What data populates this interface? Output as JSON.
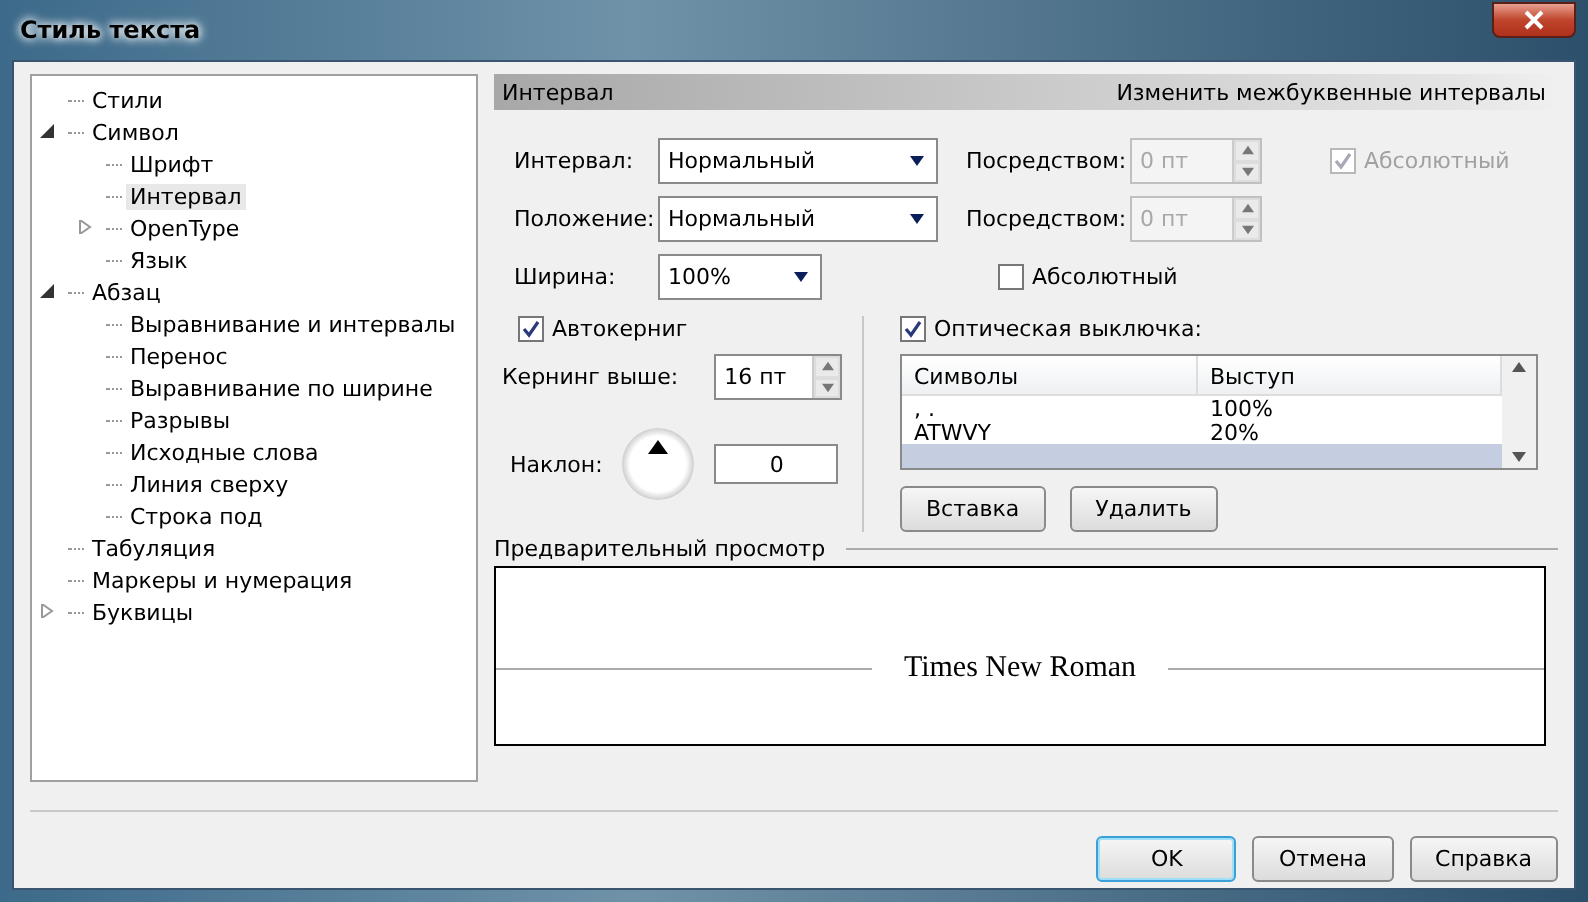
{
  "window": {
    "title": "Стиль текста"
  },
  "tree": [
    {
      "label": "Стили",
      "selected": false
    },
    {
      "label": "Символ",
      "selected": false,
      "expanded": true,
      "children": [
        {
          "label": "Шрифт",
          "selected": false
        },
        {
          "label": "Интервал",
          "selected": true
        },
        {
          "label": "OpenType",
          "selected": false,
          "expanded": false
        },
        {
          "label": "Язык",
          "selected": false
        }
      ]
    },
    {
      "label": "Абзац",
      "selected": false,
      "expanded": true,
      "children": [
        {
          "label": "Выравнивание и интервалы",
          "selected": false
        },
        {
          "label": "Перенос",
          "selected": false
        },
        {
          "label": "Выравнивание по ширине",
          "selected": false
        },
        {
          "label": "Разрывы",
          "selected": false
        },
        {
          "label": "Исходные слова",
          "selected": false
        },
        {
          "label": "Линия сверху",
          "selected": false
        },
        {
          "label": "Строка под",
          "selected": false
        }
      ]
    },
    {
      "label": "Табуляция",
      "selected": false
    },
    {
      "label": "Маркеры и нумерация",
      "selected": false
    },
    {
      "label": "Буквицы",
      "selected": false,
      "expanded": false
    }
  ],
  "header": {
    "title": "Интервал",
    "description": "Изменить межбуквенные интервалы"
  },
  "spacing_rows": [
    {
      "label": "Интервал:",
      "value": "Нормальный",
      "by_label": "Посредством:",
      "by_value": "0 пт",
      "by_disabled": true,
      "absolute": {
        "label": "Абсолютный",
        "checked": true,
        "disabled": true
      }
    },
    {
      "label": "Положение:",
      "value": "Нормальный",
      "by_label": "Посредством:",
      "by_value": "0 пт",
      "by_disabled": true
    }
  ],
  "width": {
    "label": "Ширина:",
    "value": "100%",
    "absolute": {
      "label": "Абсолютный",
      "checked": false,
      "disabled": false
    }
  },
  "autokerning": {
    "label": "Автокерниг",
    "checked": true
  },
  "kerning": {
    "label": "Кернинг выше:",
    "value": "16 пт"
  },
  "tilt": {
    "label": "Наклон:",
    "value": "0"
  },
  "optical": {
    "label": "Оптическая выключка:",
    "checked": true,
    "columns": [
      "Символы",
      "Выступ"
    ],
    "rows": [
      {
        "symbols": ", .",
        "overhang": "100%",
        "selected": false
      },
      {
        "symbols": "ATWVY",
        "overhang": "20%",
        "selected": false
      },
      {
        "selected": true
      }
    ],
    "buttons": [
      "Вставка",
      "Удалить"
    ]
  },
  "preview": {
    "label": "Предварительный просмотр",
    "sample": "Times New Roman"
  },
  "buttons": [
    {
      "label": "OK",
      "default": true
    },
    {
      "label": "Отмена",
      "default": false
    },
    {
      "label": "Справка",
      "default": false
    }
  ]
}
